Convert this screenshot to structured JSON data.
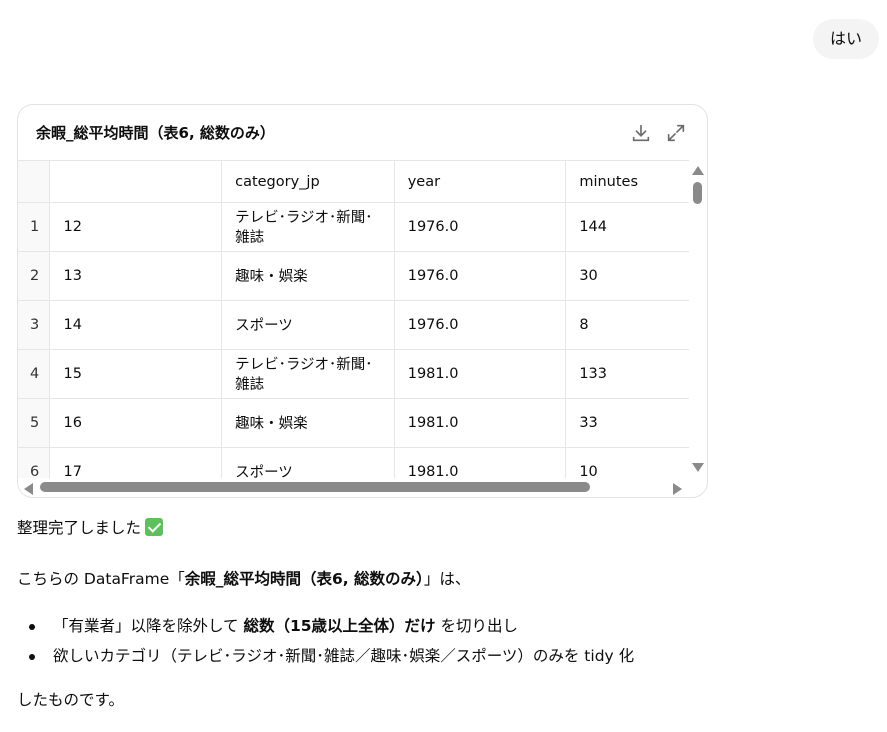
{
  "user_message": "はい",
  "dataframe": {
    "title": "余暇_総平均時間（表6, 総数のみ）",
    "download_icon": "download-icon",
    "expand_icon": "expand-icon",
    "columns": [
      "",
      "",
      "category_jp",
      "year",
      "minutes"
    ],
    "rows": [
      {
        "n": "1",
        "idx": "12",
        "cat": "テレビ･ラジオ･新聞･雑誌",
        "year": "1976.0",
        "min": "144"
      },
      {
        "n": "2",
        "idx": "13",
        "cat": "趣味・娯楽",
        "year": "1976.0",
        "min": "30"
      },
      {
        "n": "3",
        "idx": "14",
        "cat": "スポーツ",
        "year": "1976.0",
        "min": "8"
      },
      {
        "n": "4",
        "idx": "15",
        "cat": "テレビ･ラジオ･新聞･雑誌",
        "year": "1981.0",
        "min": "133"
      },
      {
        "n": "5",
        "idx": "16",
        "cat": "趣味・娯楽",
        "year": "1981.0",
        "min": "33"
      },
      {
        "n": "6",
        "idx": "17",
        "cat": "スポーツ",
        "year": "1981.0",
        "min": "10"
      }
    ]
  },
  "assistant": {
    "done_text": "整理完了しました",
    "check_icon": "check-mark-icon",
    "intro_pre": "こちらの DataFrame「",
    "intro_bold": "余暇_総平均時間（表6, 総数のみ）",
    "intro_post": "」は、",
    "bullet1_pre": "「有業者」以降を除外して ",
    "bullet1_bold": "総数（15歳以上全体）だけ",
    "bullet1_post": " を切り出し",
    "bullet2": "欲しいカテゴリ（テレビ･ラジオ･新聞･雑誌／趣味･娯楽／スポーツ）のみを tidy 化",
    "closing": "したものです。"
  }
}
